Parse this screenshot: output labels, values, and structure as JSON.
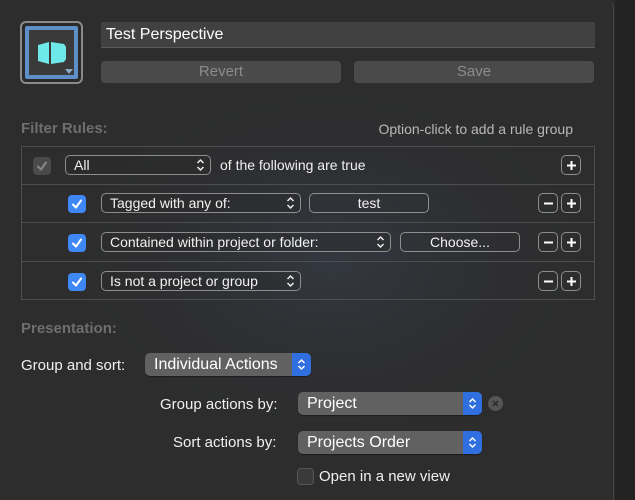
{
  "header": {
    "perspective_name": "Test Perspective",
    "icon": "perspective-icon",
    "revert_label": "Revert",
    "save_label": "Save"
  },
  "filter_rules": {
    "title": "Filter Rules:",
    "hint": "Option-click to add a rule group",
    "group": {
      "checked": true,
      "enabled": false,
      "match": "All",
      "suffix": "of the following are true"
    },
    "rules": [
      {
        "checked": true,
        "condition": "Tagged with any of:",
        "value_button": "test"
      },
      {
        "checked": true,
        "condition": "Contained within project or folder:",
        "value_button": "Choose..."
      },
      {
        "checked": true,
        "condition": "Is not a project or group"
      }
    ],
    "add_icon": "plus-icon",
    "remove_icon": "minus-icon"
  },
  "presentation": {
    "title": "Presentation:",
    "group_and_sort": {
      "label": "Group and sort:",
      "value": "Individual Actions"
    },
    "group_actions_by": {
      "label": "Group actions by:",
      "value": "Project"
    },
    "sort_actions_by": {
      "label": "Sort actions by:",
      "value": "Projects Order"
    },
    "open_new_view": {
      "label": "Open in a new view",
      "checked": false
    }
  },
  "colors": {
    "accent": "#3f87f5",
    "icon_teal": "#6ee8e8",
    "well_border": "#5e8fc9"
  }
}
